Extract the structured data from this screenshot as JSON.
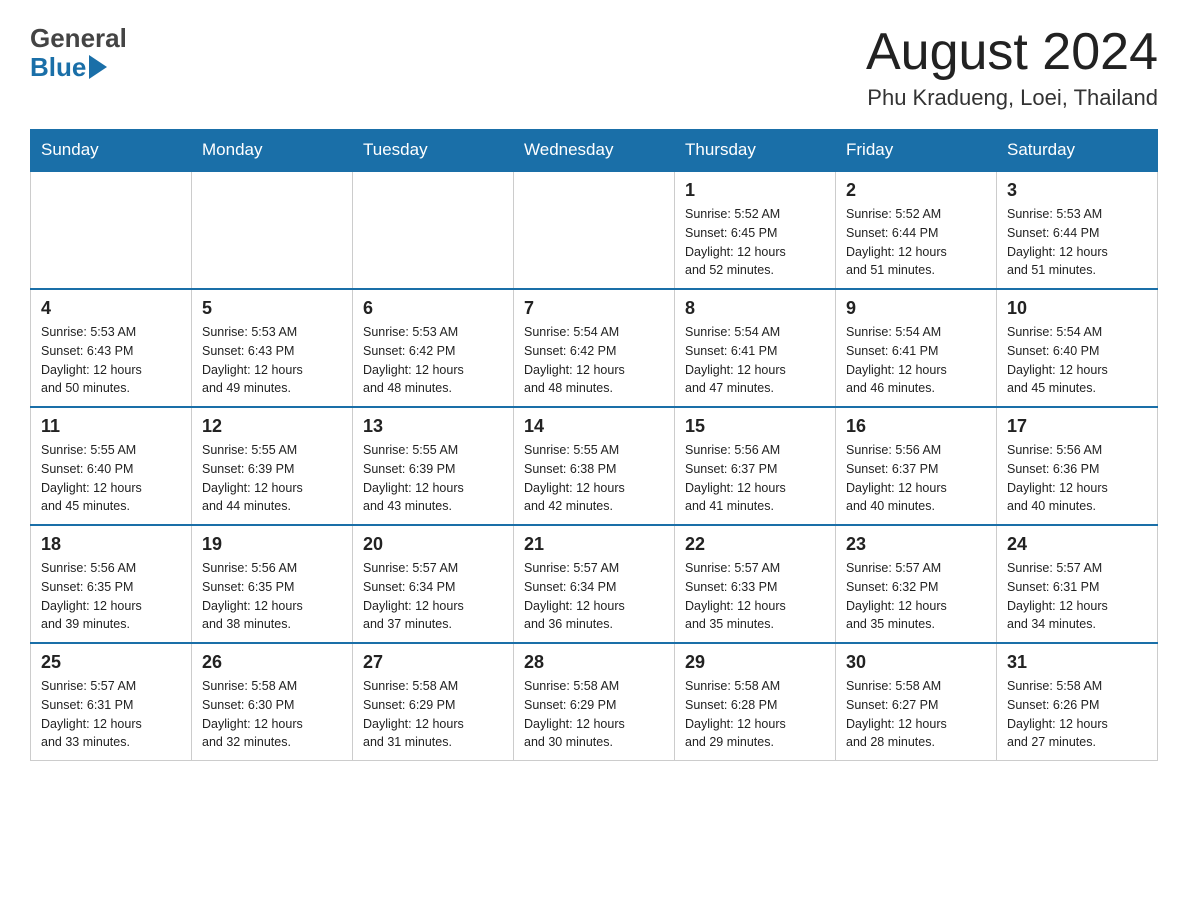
{
  "header": {
    "logo_general": "General",
    "logo_blue": "Blue",
    "month_title": "August 2024",
    "location": "Phu Kradueng, Loei, Thailand"
  },
  "days_of_week": [
    "Sunday",
    "Monday",
    "Tuesday",
    "Wednesday",
    "Thursday",
    "Friday",
    "Saturday"
  ],
  "weeks": [
    {
      "days": [
        {
          "number": "",
          "info": ""
        },
        {
          "number": "",
          "info": ""
        },
        {
          "number": "",
          "info": ""
        },
        {
          "number": "",
          "info": ""
        },
        {
          "number": "1",
          "info": "Sunrise: 5:52 AM\nSunset: 6:45 PM\nDaylight: 12 hours\nand 52 minutes."
        },
        {
          "number": "2",
          "info": "Sunrise: 5:52 AM\nSunset: 6:44 PM\nDaylight: 12 hours\nand 51 minutes."
        },
        {
          "number": "3",
          "info": "Sunrise: 5:53 AM\nSunset: 6:44 PM\nDaylight: 12 hours\nand 51 minutes."
        }
      ]
    },
    {
      "days": [
        {
          "number": "4",
          "info": "Sunrise: 5:53 AM\nSunset: 6:43 PM\nDaylight: 12 hours\nand 50 minutes."
        },
        {
          "number": "5",
          "info": "Sunrise: 5:53 AM\nSunset: 6:43 PM\nDaylight: 12 hours\nand 49 minutes."
        },
        {
          "number": "6",
          "info": "Sunrise: 5:53 AM\nSunset: 6:42 PM\nDaylight: 12 hours\nand 48 minutes."
        },
        {
          "number": "7",
          "info": "Sunrise: 5:54 AM\nSunset: 6:42 PM\nDaylight: 12 hours\nand 48 minutes."
        },
        {
          "number": "8",
          "info": "Sunrise: 5:54 AM\nSunset: 6:41 PM\nDaylight: 12 hours\nand 47 minutes."
        },
        {
          "number": "9",
          "info": "Sunrise: 5:54 AM\nSunset: 6:41 PM\nDaylight: 12 hours\nand 46 minutes."
        },
        {
          "number": "10",
          "info": "Sunrise: 5:54 AM\nSunset: 6:40 PM\nDaylight: 12 hours\nand 45 minutes."
        }
      ]
    },
    {
      "days": [
        {
          "number": "11",
          "info": "Sunrise: 5:55 AM\nSunset: 6:40 PM\nDaylight: 12 hours\nand 45 minutes."
        },
        {
          "number": "12",
          "info": "Sunrise: 5:55 AM\nSunset: 6:39 PM\nDaylight: 12 hours\nand 44 minutes."
        },
        {
          "number": "13",
          "info": "Sunrise: 5:55 AM\nSunset: 6:39 PM\nDaylight: 12 hours\nand 43 minutes."
        },
        {
          "number": "14",
          "info": "Sunrise: 5:55 AM\nSunset: 6:38 PM\nDaylight: 12 hours\nand 42 minutes."
        },
        {
          "number": "15",
          "info": "Sunrise: 5:56 AM\nSunset: 6:37 PM\nDaylight: 12 hours\nand 41 minutes."
        },
        {
          "number": "16",
          "info": "Sunrise: 5:56 AM\nSunset: 6:37 PM\nDaylight: 12 hours\nand 40 minutes."
        },
        {
          "number": "17",
          "info": "Sunrise: 5:56 AM\nSunset: 6:36 PM\nDaylight: 12 hours\nand 40 minutes."
        }
      ]
    },
    {
      "days": [
        {
          "number": "18",
          "info": "Sunrise: 5:56 AM\nSunset: 6:35 PM\nDaylight: 12 hours\nand 39 minutes."
        },
        {
          "number": "19",
          "info": "Sunrise: 5:56 AM\nSunset: 6:35 PM\nDaylight: 12 hours\nand 38 minutes."
        },
        {
          "number": "20",
          "info": "Sunrise: 5:57 AM\nSunset: 6:34 PM\nDaylight: 12 hours\nand 37 minutes."
        },
        {
          "number": "21",
          "info": "Sunrise: 5:57 AM\nSunset: 6:34 PM\nDaylight: 12 hours\nand 36 minutes."
        },
        {
          "number": "22",
          "info": "Sunrise: 5:57 AM\nSunset: 6:33 PM\nDaylight: 12 hours\nand 35 minutes."
        },
        {
          "number": "23",
          "info": "Sunrise: 5:57 AM\nSunset: 6:32 PM\nDaylight: 12 hours\nand 35 minutes."
        },
        {
          "number": "24",
          "info": "Sunrise: 5:57 AM\nSunset: 6:31 PM\nDaylight: 12 hours\nand 34 minutes."
        }
      ]
    },
    {
      "days": [
        {
          "number": "25",
          "info": "Sunrise: 5:57 AM\nSunset: 6:31 PM\nDaylight: 12 hours\nand 33 minutes."
        },
        {
          "number": "26",
          "info": "Sunrise: 5:58 AM\nSunset: 6:30 PM\nDaylight: 12 hours\nand 32 minutes."
        },
        {
          "number": "27",
          "info": "Sunrise: 5:58 AM\nSunset: 6:29 PM\nDaylight: 12 hours\nand 31 minutes."
        },
        {
          "number": "28",
          "info": "Sunrise: 5:58 AM\nSunset: 6:29 PM\nDaylight: 12 hours\nand 30 minutes."
        },
        {
          "number": "29",
          "info": "Sunrise: 5:58 AM\nSunset: 6:28 PM\nDaylight: 12 hours\nand 29 minutes."
        },
        {
          "number": "30",
          "info": "Sunrise: 5:58 AM\nSunset: 6:27 PM\nDaylight: 12 hours\nand 28 minutes."
        },
        {
          "number": "31",
          "info": "Sunrise: 5:58 AM\nSunset: 6:26 PM\nDaylight: 12 hours\nand 27 minutes."
        }
      ]
    }
  ]
}
